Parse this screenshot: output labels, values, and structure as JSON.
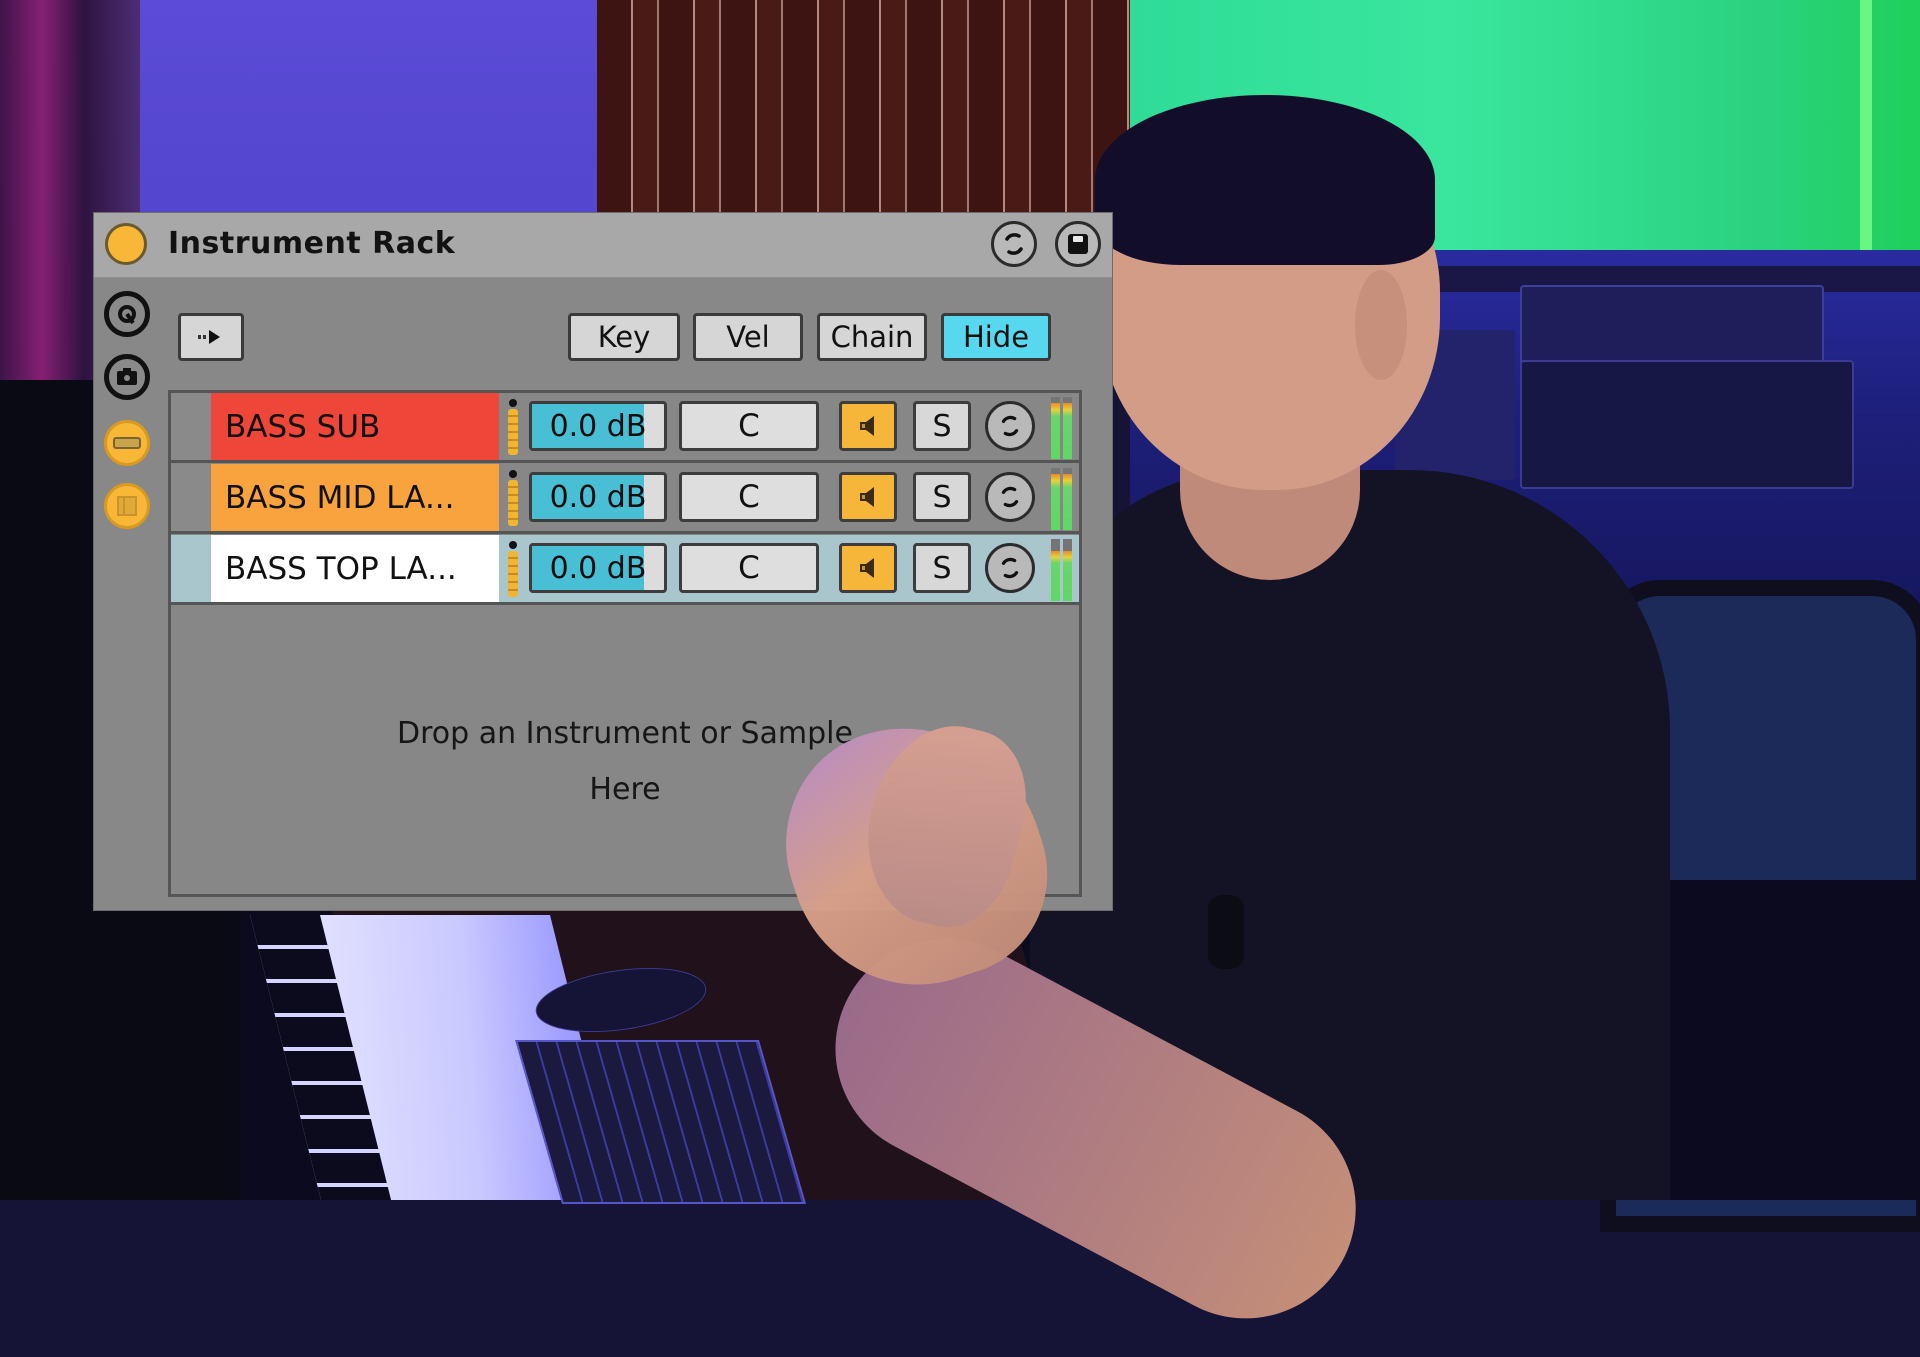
{
  "rack": {
    "title": "Instrument Rack",
    "device_on": true,
    "accent_color": "#f9b737",
    "title_buttons": [
      {
        "name": "hot-swap",
        "icon": "hot-swap-icon"
      },
      {
        "name": "save-preset",
        "icon": "save-icon"
      }
    ],
    "sidebar_buttons": [
      {
        "name": "show-macros",
        "icon": "macro-knob-icon",
        "active": false
      },
      {
        "name": "randomize-snapshot",
        "icon": "camera-icon",
        "active": false
      },
      {
        "name": "show-chain-list",
        "icon": "chain-list-icon",
        "active": true
      },
      {
        "name": "show-devices",
        "icon": "devices-icon",
        "active": true
      }
    ],
    "auto_select_icon": "auto-select-arrow-icon",
    "header_buttons": [
      {
        "label": "Key",
        "active": false
      },
      {
        "label": "Vel",
        "active": false
      },
      {
        "label": "Chain",
        "active": false
      },
      {
        "label": "Hide",
        "active": true
      }
    ],
    "chains": [
      {
        "name": "BASS SUB",
        "color": "#ee4638",
        "selector_color": "#8a8a8a",
        "volume": "0.0 dB",
        "volume_fraction": 0.85,
        "pan": "C",
        "active": true,
        "solo_label": "S",
        "meter_level": 0.9,
        "selected": false
      },
      {
        "name": "BASS MID LA...",
        "color": "#f8a33d",
        "selector_color": "#8a8a8a",
        "volume": "0.0 dB",
        "volume_fraction": 0.85,
        "pan": "C",
        "active": true,
        "solo_label": "S",
        "meter_level": 0.9,
        "selected": false
      },
      {
        "name": "BASS TOP LA...",
        "color": "#ffffff",
        "selector_color": "#a9c6cd",
        "volume": "0.0 dB",
        "volume_fraction": 0.85,
        "pan": "C",
        "active": true,
        "solo_label": "S",
        "meter_level": 0.8,
        "selected": true
      }
    ],
    "drop_text_line1": "Drop an Instrument or Sample",
    "drop_text_line2": "Here"
  }
}
